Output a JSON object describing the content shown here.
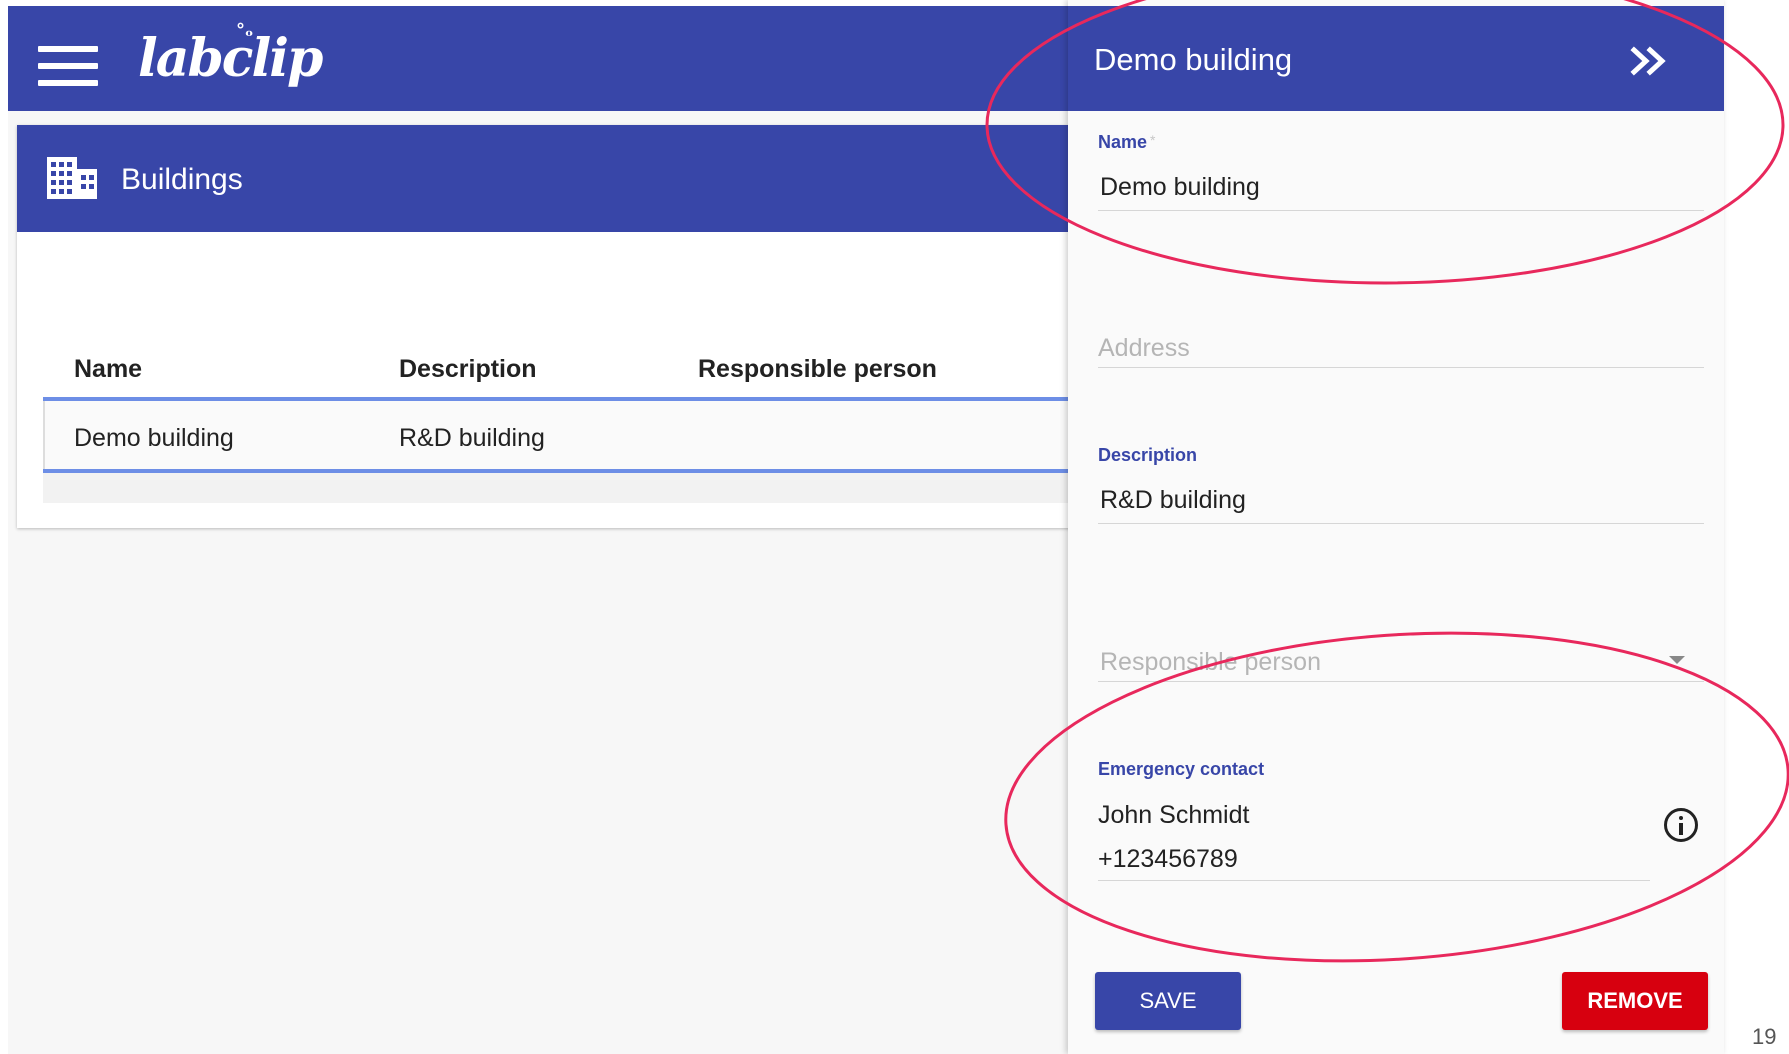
{
  "app": {
    "logo_text": "labclip",
    "menu_icon": "hamburger-menu-icon",
    "brand_color": "#3846a8"
  },
  "page": {
    "title": "Buildings",
    "title_icon": "building-icon"
  },
  "table": {
    "columns": [
      "Name",
      "Description",
      "Responsible person"
    ],
    "rows": [
      {
        "name": "Demo building",
        "description": "R&D building",
        "responsible": ""
      }
    ]
  },
  "drawer": {
    "title": "Demo building",
    "collapse_icon": "double-chevron-right-icon",
    "fields": {
      "name": {
        "label": "Name",
        "required_mark": "*",
        "value": "Demo building"
      },
      "address": {
        "placeholder": "Address",
        "value": ""
      },
      "description": {
        "label": "Description",
        "value": "R&D building"
      },
      "responsible": {
        "placeholder": "Responsible person",
        "value": ""
      },
      "emergency": {
        "label": "Emergency contact",
        "line1": "John Schmidt",
        "line2": "+123456789"
      }
    },
    "save_label": "SAVE",
    "remove_label": "REMOVE",
    "remove_color": "#d7000f"
  },
  "slide_number": "19",
  "annotation_color": "#e8285c"
}
